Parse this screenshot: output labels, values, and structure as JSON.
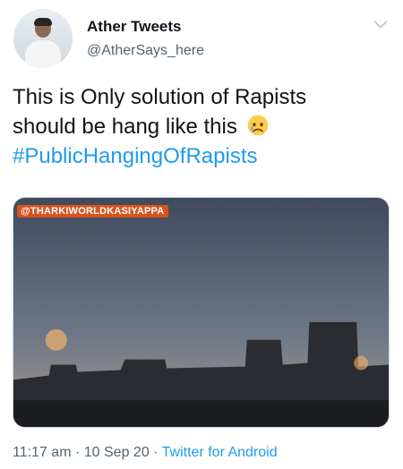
{
  "author": {
    "name": "Ather Tweets",
    "handle": "@AtherSays_here"
  },
  "tweet": {
    "line1": "This is Only solution of Rapists",
    "line2": "should be hang like this",
    "hashtag": "#PublicHangingOfRapists"
  },
  "media": {
    "watermark": "@THARKIWORLDKASIYAPPA"
  },
  "meta": {
    "time": "11:17 am",
    "date": "10 Sep 20",
    "source": "Twitter for Android",
    "separator": "·"
  },
  "colors": {
    "accent": "#1d9bf0",
    "secondary_text": "#536471"
  },
  "icons": {
    "menu": "chevron-down-icon",
    "emoji": "sad-face-emoji"
  }
}
